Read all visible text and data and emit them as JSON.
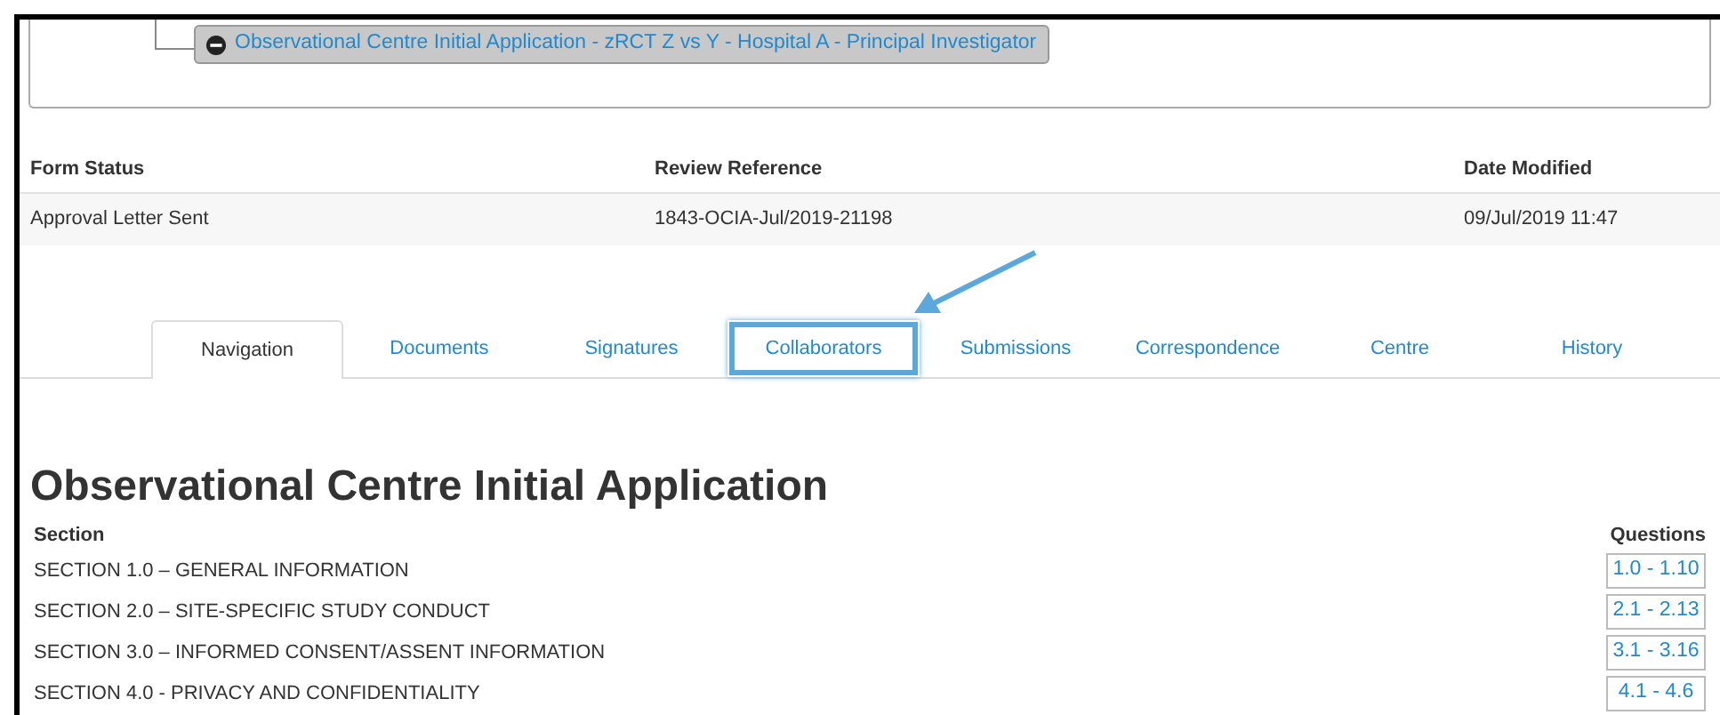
{
  "breadcrumb": {
    "label": "Observational Centre Initial Application - zRCT Z vs Y - Hospital A - Principal Investigator",
    "expanded": true
  },
  "summary": {
    "columns": [
      "Form Status",
      "Review Reference",
      "Date Modified"
    ],
    "values": [
      "Approval Letter Sent",
      "1843-OCIA-Jul/2019-21198",
      "09/Jul/2019 11:47"
    ]
  },
  "tabs": [
    {
      "label": "Navigation",
      "selected": true,
      "highlighted": false
    },
    {
      "label": "Documents",
      "selected": false,
      "highlighted": false
    },
    {
      "label": "Signatures",
      "selected": false,
      "highlighted": false
    },
    {
      "label": "Collaborators",
      "selected": false,
      "highlighted": true
    },
    {
      "label": "Submissions",
      "selected": false,
      "highlighted": false
    },
    {
      "label": "Correspondence",
      "selected": false,
      "highlighted": false
    },
    {
      "label": "Centre",
      "selected": false,
      "highlighted": false
    },
    {
      "label": "History",
      "selected": false,
      "highlighted": false
    }
  ],
  "heading": "Observational Centre Initial Application",
  "sections": {
    "columns": [
      "Section",
      "Questions"
    ],
    "rows": [
      {
        "section": "SECTION 1.0 – GENERAL INFORMATION",
        "questions": "1.0 - 1.10"
      },
      {
        "section": "SECTION 2.0 – SITE-SPECIFIC STUDY CONDUCT",
        "questions": "2.1 - 2.13"
      },
      {
        "section": "SECTION 3.0 – INFORMED CONSENT/ASSENT INFORMATION",
        "questions": "3.1 - 3.16"
      },
      {
        "section": "SECTION 4.0 - PRIVACY AND CONFIDENTIALITY",
        "questions": "4.1 - 4.6"
      }
    ]
  }
}
